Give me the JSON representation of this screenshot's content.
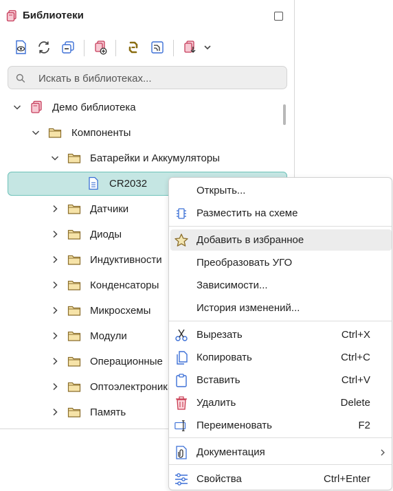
{
  "panel": {
    "title": "Библиотеки",
    "title_icon": "library-books-icon",
    "maximize_icon": "maximize-icon"
  },
  "toolbar": {
    "buttons": [
      {
        "icon": "view-document-icon"
      },
      {
        "icon": "refresh-icon"
      },
      {
        "icon": "collapse-all-icon"
      },
      {
        "icon": "add-library-icon"
      },
      {
        "icon": "link-icon"
      },
      {
        "icon": "symbol-editor-icon"
      },
      {
        "icon": "import-library-icon"
      },
      {
        "icon": "chevron-down-icon"
      }
    ]
  },
  "search": {
    "placeholder": "Искать в библиотеках..."
  },
  "tree": {
    "rows": [
      {
        "label": "Демо библиотека",
        "icon": "library-icon",
        "expanded": true
      },
      {
        "label": "Компоненты",
        "icon": "folder-icon",
        "expanded": true
      },
      {
        "label": "Батарейки и Аккумуляторы",
        "icon": "folder-icon",
        "expanded": true
      },
      {
        "label": "CR2032",
        "icon": "document-icon",
        "selected": true
      },
      {
        "label": "Датчики",
        "icon": "folder-icon"
      },
      {
        "label": "Диоды",
        "icon": "folder-icon"
      },
      {
        "label": "Индуктивности",
        "icon": "folder-icon"
      },
      {
        "label": "Конденсаторы",
        "icon": "folder-icon"
      },
      {
        "label": "Микросхемы",
        "icon": "folder-icon"
      },
      {
        "label": "Модули",
        "icon": "folder-icon"
      },
      {
        "label": "Операционные",
        "icon": "folder-icon"
      },
      {
        "label": "Оптоэлектроника",
        "icon": "folder-icon"
      },
      {
        "label": "Память",
        "icon": "folder-icon"
      }
    ]
  },
  "context_menu": {
    "items": [
      {
        "label": "Открыть...",
        "icon": "",
        "shortcut": ""
      },
      {
        "label": "Разместить на схеме",
        "icon": "component-place-icon",
        "shortcut": ""
      },
      {
        "label": "Добавить в избранное",
        "icon": "star-icon",
        "shortcut": "",
        "hovered": true
      },
      {
        "label": "Преобразовать УГО",
        "icon": "",
        "shortcut": ""
      },
      {
        "label": "Зависимости...",
        "icon": "",
        "shortcut": ""
      },
      {
        "label": "История изменений...",
        "icon": "",
        "shortcut": ""
      },
      {
        "label": "Вырезать",
        "icon": "scissors-icon",
        "shortcut": "Ctrl+X"
      },
      {
        "label": "Копировать",
        "icon": "copy-icon",
        "shortcut": "Ctrl+C"
      },
      {
        "label": "Вставить",
        "icon": "paste-icon",
        "shortcut": "Ctrl+V"
      },
      {
        "label": "Удалить",
        "icon": "trash-icon",
        "shortcut": "Delete"
      },
      {
        "label": "Переименовать",
        "icon": "rename-icon",
        "shortcut": "F2"
      },
      {
        "label": "Документация",
        "icon": "attachment-icon",
        "shortcut": "",
        "submenu": true
      },
      {
        "label": "Свойства",
        "icon": "sliders-icon",
        "shortcut": "Ctrl+Enter"
      }
    ]
  },
  "colors": {
    "accent_blue": "#3b6fd6",
    "library_red": "#c53d5b",
    "folder_fill": "#f6e3a8",
    "folder_stroke": "#8a6d2b",
    "selection_bg": "#c5e6e3",
    "selection_border": "#6cc1b8",
    "star_fill": "#f3e6b3",
    "trash_red": "#c8394f"
  }
}
